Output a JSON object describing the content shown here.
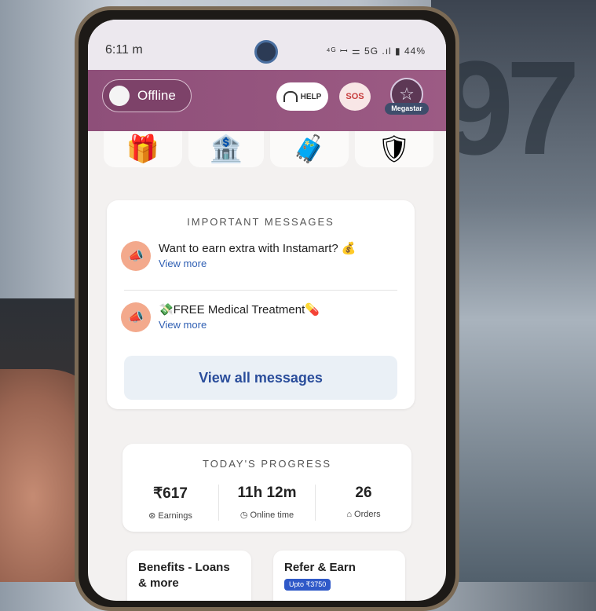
{
  "status_bar": {
    "time": "6:11 m",
    "icons": "⁴ᴳ ꟷ ⚌ 5G .ıl ▮ 44%"
  },
  "header": {
    "toggle_label": "Offline",
    "help_label": "HELP",
    "sos_label": "SOS",
    "badge_label": "Megastar"
  },
  "important_messages": {
    "title": "IMPORTANT MESSAGES",
    "items": [
      {
        "title": "Want to earn extra with Instamart? 💰",
        "link": "View more"
      },
      {
        "title": "💸FREE Medical Treatment💊",
        "link": "View more"
      }
    ],
    "view_all": "View all messages"
  },
  "progress": {
    "title": "TODAY'S PROGRESS",
    "stats": [
      {
        "value": "₹617",
        "label": "Earnings"
      },
      {
        "value": "11h 12m",
        "label": "Online time"
      },
      {
        "value": "26",
        "label": "Orders"
      }
    ]
  },
  "cards": {
    "benefits": "Benefits - Loans & more",
    "refer": "Refer & Earn",
    "refer_pill": "Upto ₹3750"
  }
}
